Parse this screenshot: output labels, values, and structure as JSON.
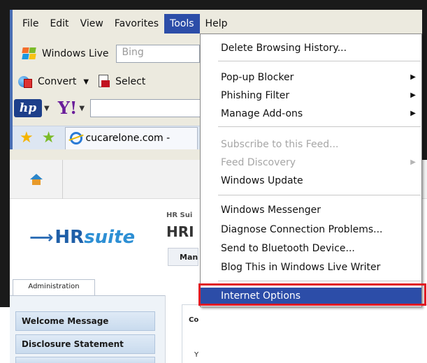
{
  "menubar": {
    "items": [
      "File",
      "Edit",
      "View",
      "Favorites",
      "Tools",
      "Help"
    ],
    "active": "Tools"
  },
  "toolbar": {
    "windows_live_label": "Windows Live",
    "bing_placeholder": "Bing",
    "convert_label": "Convert",
    "select_label": "Select"
  },
  "tab": {
    "title": "cucarelone.com -"
  },
  "tools_menu": {
    "delete_history": "Delete Browsing History...",
    "popup_blocker": "Pop-up Blocker",
    "phishing_filter": "Phishing Filter",
    "manage_addons": "Manage Add-ons",
    "subscribe_feed": "Subscribe to this Feed...",
    "feed_discovery": "Feed Discovery",
    "windows_update": "Windows Update",
    "windows_messenger": "Windows Messenger",
    "diagnose": "Diagnose Connection Problems...",
    "bluetooth": "Send to Bluetooth Device...",
    "blog_this": "Blog This in Windows Live Writer",
    "internet_options": "Internet Options"
  },
  "page": {
    "logo_hr": "HR",
    "logo_suite": "suite",
    "header_small": "HR Sui",
    "header_big": "HRI",
    "manage_button": "Man",
    "admin_tab": "Administration",
    "sidebar": [
      "Welcome Message",
      "Disclosure Statement"
    ],
    "content_heading": "Co",
    "content_text": "Y"
  },
  "colors": {
    "menu_highlight": "#2c4da8",
    "annotation_red": "#e01b24"
  }
}
